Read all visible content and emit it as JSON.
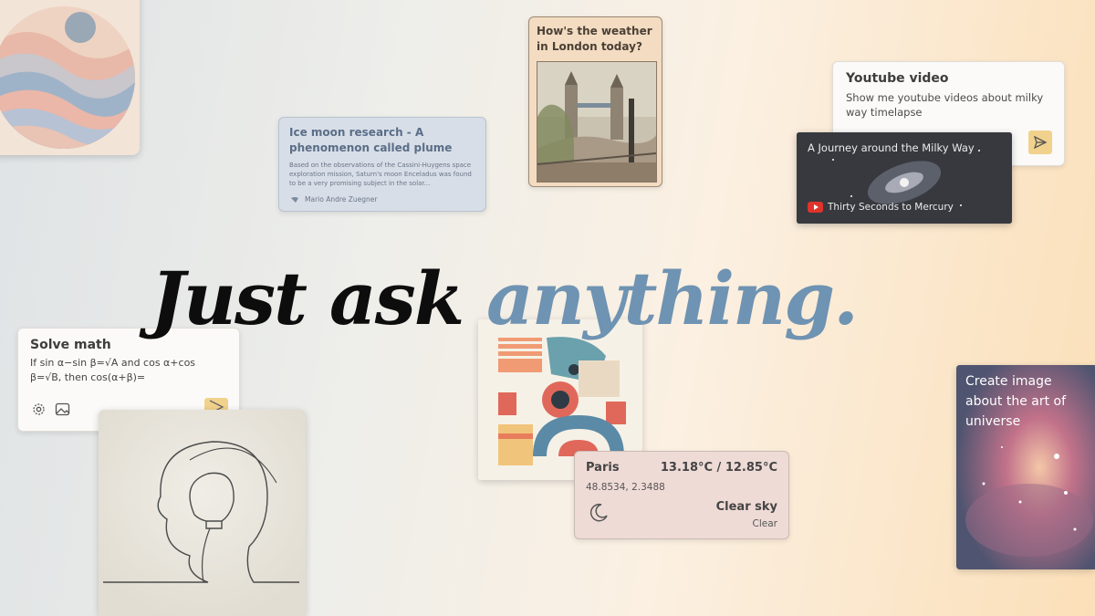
{
  "research": {
    "title": "Ice moon research - A phenomenon called plume",
    "body": "Based on the observations of the Cassini-Huygens space exploration mission, Saturn's moon Enceladus was found to be a very promising subject in the solar...",
    "author": "Mario Andre Zuegner"
  },
  "weather_london": {
    "question": "How's the weather in London today?"
  },
  "youtube": {
    "title": "Youtube video",
    "prompt": "Show me youtube videos about milky way timelapse",
    "result_title": "A Journey around the Milky Way",
    "channel": "Thirty Seconds to Mercury"
  },
  "headline": {
    "part1": "Just ask ",
    "part2": "anything."
  },
  "math": {
    "title": "Solve math",
    "problem": "If sin α−sin β=√A and cos α+cos β=√B, then cos(α+β)="
  },
  "paris": {
    "city": "Paris",
    "temps": "13.18°C / 12.85°C",
    "coords": "48.8534, 2.3488",
    "condition": "Clear sky",
    "condition_detail": "Clear"
  },
  "universe": {
    "prompt": "Create image about the art of universe"
  },
  "colors": {
    "headline_dark": "#0d0d0d",
    "headline_accent": "#6f93b2",
    "send_button": "#f1d28c",
    "youtube_red": "#e0332b"
  },
  "icons": [
    "send-icon",
    "gear-icon",
    "image-icon",
    "moon-icon",
    "youtube-icon",
    "author-logo-icon"
  ]
}
